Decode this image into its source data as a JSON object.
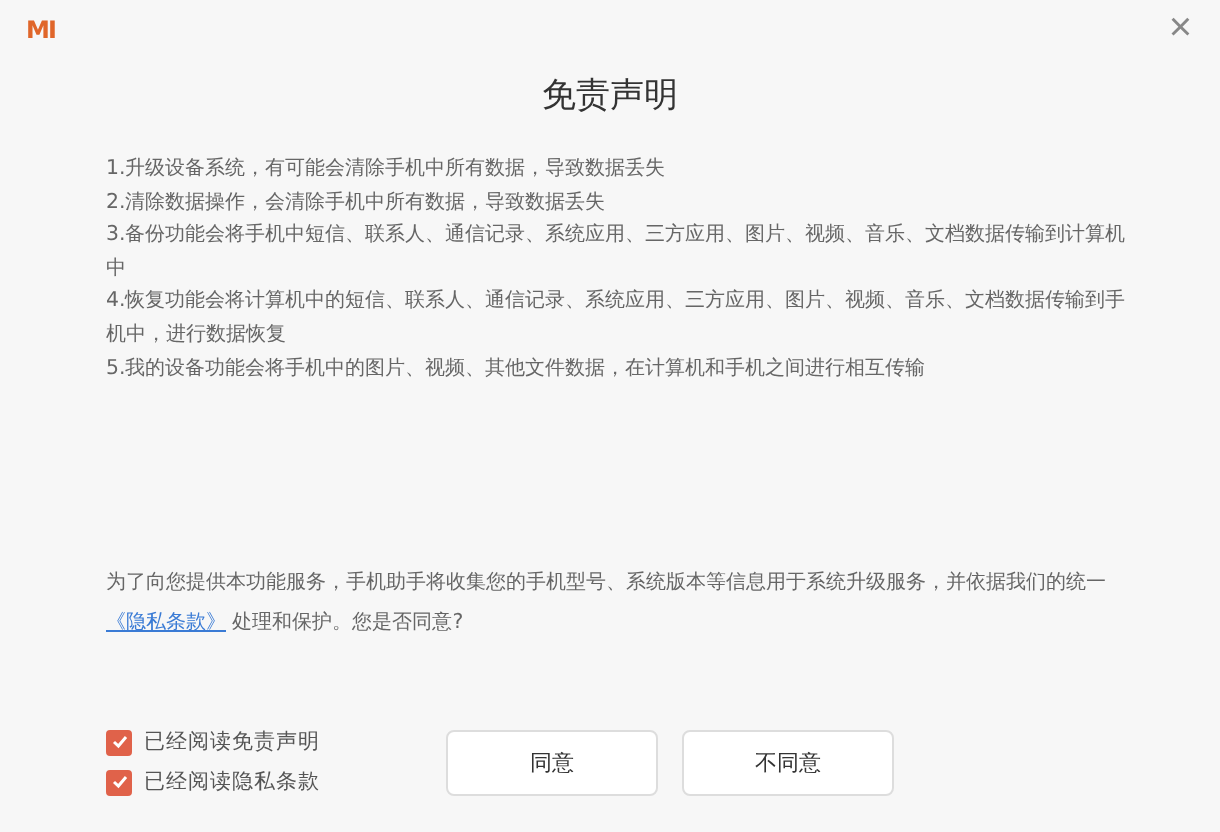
{
  "window": {
    "logo": "MI",
    "close": "×"
  },
  "title": "免责声明",
  "items": [
    "1.升级设备系统，有可能会清除手机中所有数据，导致数据丢失",
    "2.清除数据操作，会清除手机中所有数据，导致数据丢失",
    "3.备份功能会将手机中短信、联系人、通信记录、系统应用、三方应用、图片、视频、音乐、文档数据传输到计算机中",
    "4.恢复功能会将计算机中的短信、联系人、通信记录、系统应用、三方应用、图片、视频、音乐、文档数据传输到手机中，进行数据恢复",
    "5.我的设备功能会将手机中的图片、视频、其他文件数据，在计算机和手机之间进行相互传输"
  ],
  "consent": {
    "before": "为了向您提供本功能服务，手机助手将收集您的手机型号、系统版本等信息用于系统升级服务，并依据我们的统一 ",
    "link": "《隐私条款》",
    "after": " 处理和保护。您是否同意?"
  },
  "checkboxes": [
    {
      "label": "已经阅读免责声明",
      "checked": true
    },
    {
      "label": "已经阅读隐私条款",
      "checked": true
    }
  ],
  "buttons": [
    "同意",
    "不同意"
  ]
}
